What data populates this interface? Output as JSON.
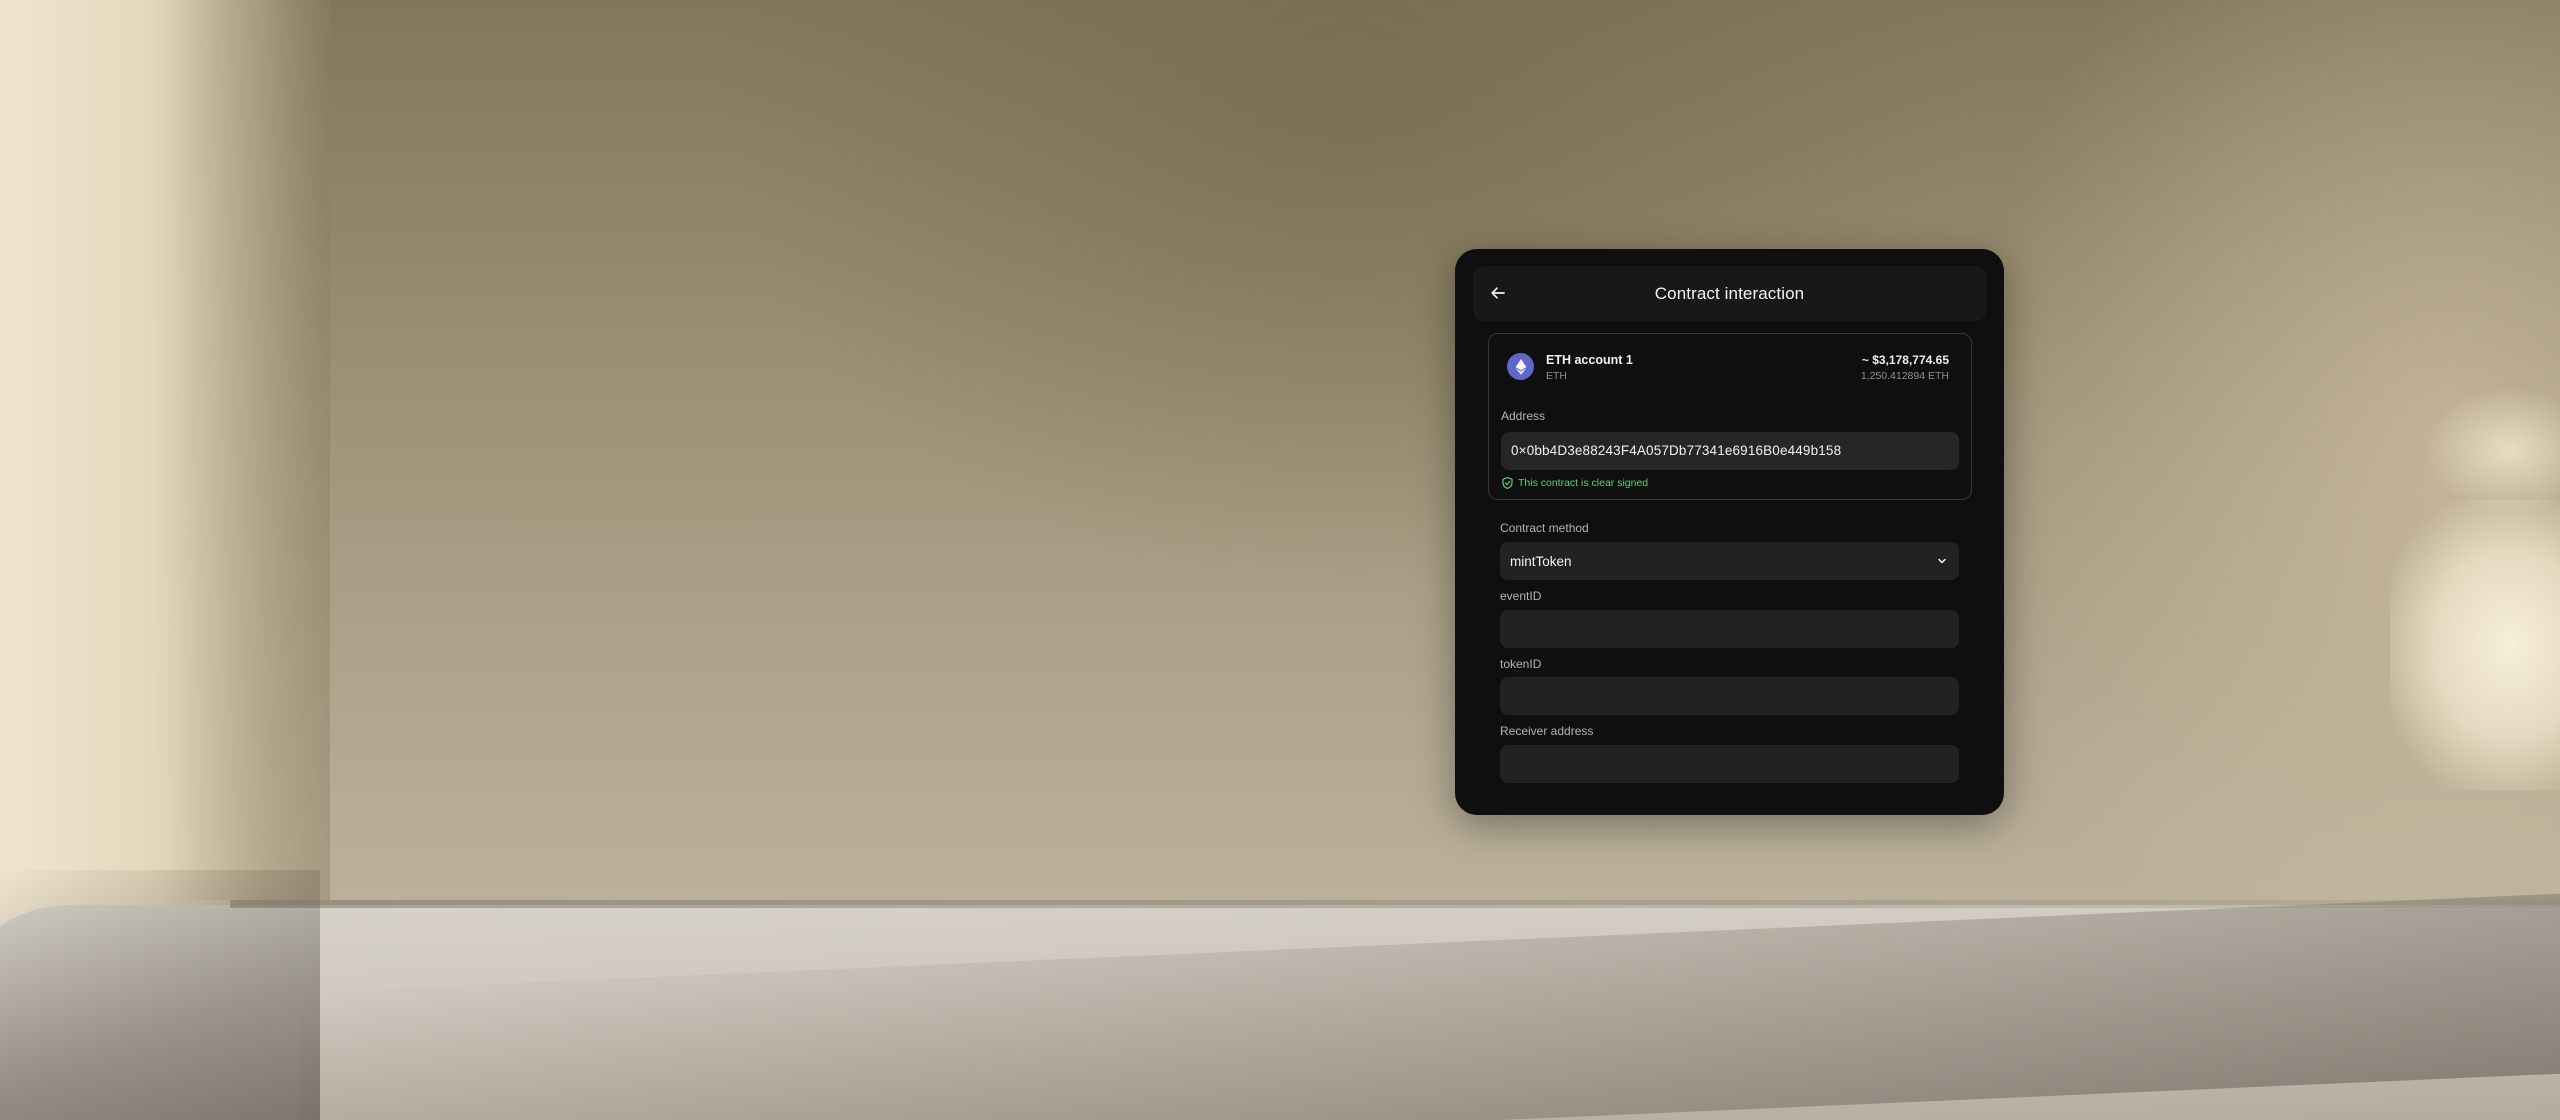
{
  "header": {
    "title": "Contract interaction",
    "back_icon": "arrow-left-icon"
  },
  "account": {
    "name": "ETH account 1",
    "ticker": "ETH",
    "usd_value": "~ $3,178,774.65",
    "eth_balance": "1,250.412894 ETH",
    "logo_icon": "ethereum-icon",
    "logo_color": "#5f68c8"
  },
  "address": {
    "label": "Address",
    "value": "0×0bb4D3e88243F4A057Db77341e6916B0e449b158",
    "clear_signed_text": "This contract is clear signed",
    "clear_signed_icon": "shield-check-icon",
    "clear_signed_color": "#5fd16b"
  },
  "contract_method": {
    "label": "Contract method",
    "selected": "mintToken"
  },
  "fields": {
    "event_id": {
      "label": "eventID",
      "value": ""
    },
    "token_id": {
      "label": "tokenID",
      "value": ""
    },
    "receiver_address": {
      "label": "Receiver address",
      "value": ""
    }
  }
}
